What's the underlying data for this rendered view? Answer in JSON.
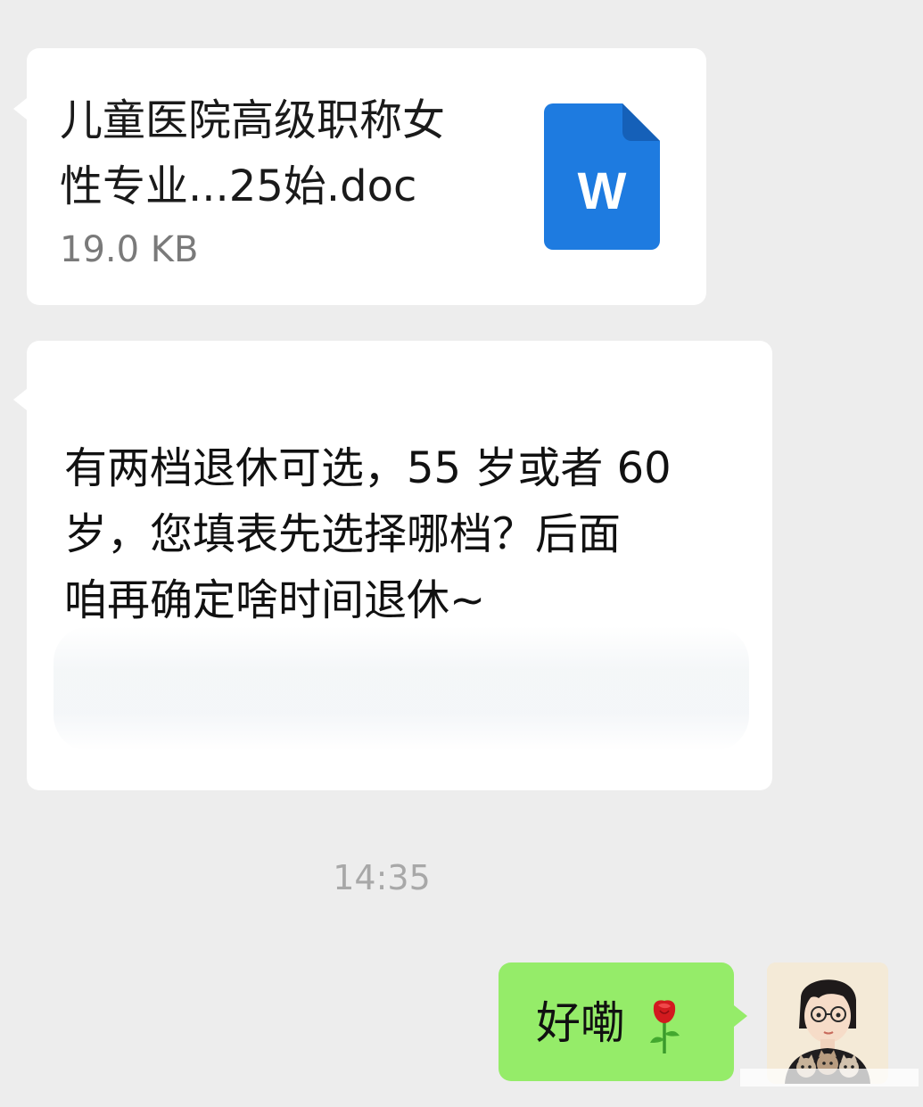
{
  "colors": {
    "background": "#ededed",
    "bubble_incoming": "#ffffff",
    "bubble_outgoing": "#95ec69",
    "word_icon_blue": "#1e7be0",
    "timestamp_gray": "#a8a8a8"
  },
  "messages": {
    "file": {
      "name_line1": "儿童医院高级职称女",
      "name_line2": "性专业...25始.doc",
      "size": "19.0 KB",
      "icon": "word-doc-icon",
      "icon_letter": "W"
    },
    "text": {
      "line1": "有两档退休可选，55 岁或者 60",
      "line2": "岁，您填表先选择哪档？后面",
      "line3": "咱再确定啥时间退休~"
    },
    "timestamp": "14:35",
    "reply": {
      "text": "好嘞",
      "emoji": "rose-icon"
    },
    "avatar": "avatar-girl-with-cats"
  }
}
